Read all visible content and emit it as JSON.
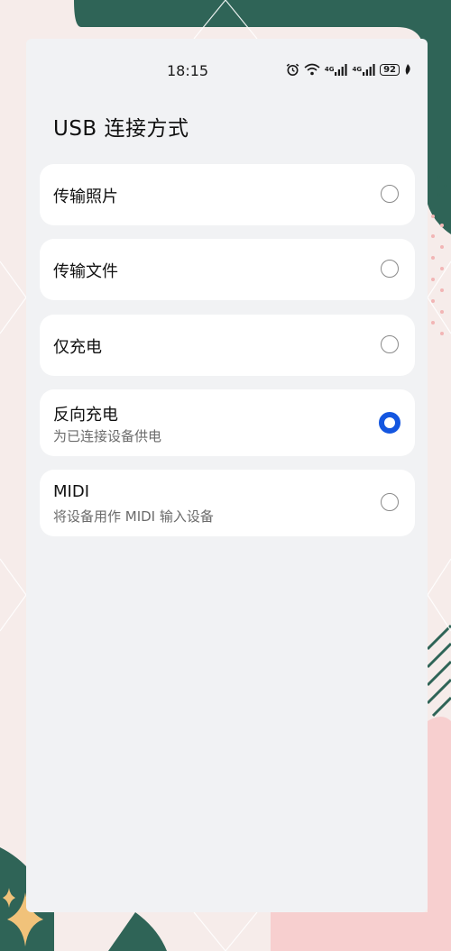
{
  "status_bar": {
    "time": "18:15",
    "network_1": "4G",
    "network_2": "4G",
    "battery": "92",
    "icons": [
      "alarm-icon",
      "wifi-icon",
      "signal-icon",
      "signal-icon",
      "battery-icon",
      "leaf-icon"
    ]
  },
  "page": {
    "title": "USB 连接方式"
  },
  "options": [
    {
      "label": "传输照片",
      "sublabel": "",
      "selected": false
    },
    {
      "label": "传输文件",
      "sublabel": "",
      "selected": false
    },
    {
      "label": "仅充电",
      "sublabel": "",
      "selected": false
    },
    {
      "label": "反向充电",
      "sublabel": "为已连接设备供电",
      "selected": true
    },
    {
      "label": "MIDI",
      "sublabel": "将设备用作 MIDI 输入设备",
      "selected": false
    }
  ],
  "colors": {
    "accent": "#1456e0",
    "panel_bg": "#f1f2f4",
    "card_bg": "#ffffff",
    "wallpaper_green": "#2f6457",
    "wallpaper_pink": "#f7cfcf"
  }
}
